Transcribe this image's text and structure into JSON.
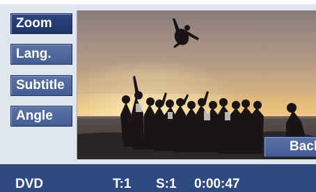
{
  "side_menu": {
    "items": [
      {
        "label": "Zoom"
      },
      {
        "label": "Lang."
      },
      {
        "label": "Subtitle"
      },
      {
        "label": "Angle"
      }
    ]
  },
  "video": {
    "description_icon": "beach-sunset-video"
  },
  "back_button": {
    "label": "Back"
  },
  "status_bar": {
    "source": "DVD",
    "title": "T:1",
    "scene": "S:1",
    "time": "0:00:47"
  },
  "colors": {
    "button_fill": "#4f689c",
    "status_bar": "#2f4a7e",
    "panel": "#dfe6f0"
  }
}
